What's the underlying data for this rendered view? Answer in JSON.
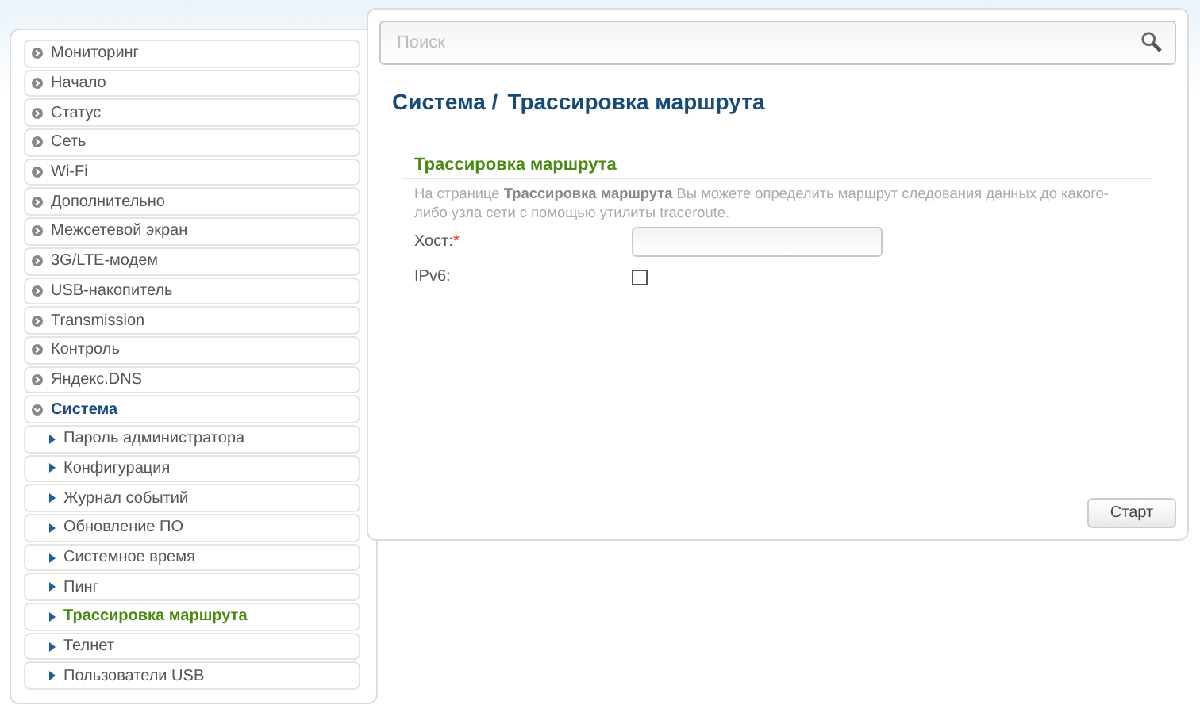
{
  "menu": [
    {
      "label": "Мониторинг",
      "expanded": false,
      "selected": false
    },
    {
      "label": "Начало",
      "expanded": false,
      "selected": false
    },
    {
      "label": "Статус",
      "expanded": false,
      "selected": false
    },
    {
      "label": "Сеть",
      "expanded": false,
      "selected": false
    },
    {
      "label": "Wi-Fi",
      "expanded": false,
      "selected": false
    },
    {
      "label": "Дополнительно",
      "expanded": false,
      "selected": false
    },
    {
      "label": "Межсетевой экран",
      "expanded": false,
      "selected": false
    },
    {
      "label": "3G/LTE-модем",
      "expanded": false,
      "selected": false
    },
    {
      "label": "USB-накопитель",
      "expanded": false,
      "selected": false
    },
    {
      "label": "Transmission",
      "expanded": false,
      "selected": false
    },
    {
      "label": "Контроль",
      "expanded": false,
      "selected": false
    },
    {
      "label": "Яндекс.DNS",
      "expanded": false,
      "selected": false
    },
    {
      "label": "Система",
      "expanded": true,
      "selected": true,
      "children": [
        {
          "label": "Пароль администратора",
          "selected": false
        },
        {
          "label": "Конфигурация",
          "selected": false
        },
        {
          "label": "Журнал событий",
          "selected": false
        },
        {
          "label": "Обновление ПО",
          "selected": false
        },
        {
          "label": "Системное время",
          "selected": false
        },
        {
          "label": "Пинг",
          "selected": false
        },
        {
          "label": "Трассировка маршрута",
          "selected": true
        },
        {
          "label": "Телнет",
          "selected": false
        },
        {
          "label": "Пользователи USB",
          "selected": false
        }
      ]
    }
  ],
  "search": {
    "placeholder": "Поиск"
  },
  "breadcrumb": [
    "Система /",
    "Трассировка маршрута"
  ],
  "section": {
    "title": "Трассировка маршрута",
    "description": "На странице **Трассировка маршрута** Вы можете определить маршрут следования данных до какого-либо узла сети с помощью утилиты traceroute."
  },
  "fields": [
    {
      "kind": "text",
      "label": "Хост:",
      "required_mark": "*"
    },
    {
      "kind": "checkbox",
      "label": "IPv6:",
      "checked": false
    }
  ],
  "button": "Старт"
}
